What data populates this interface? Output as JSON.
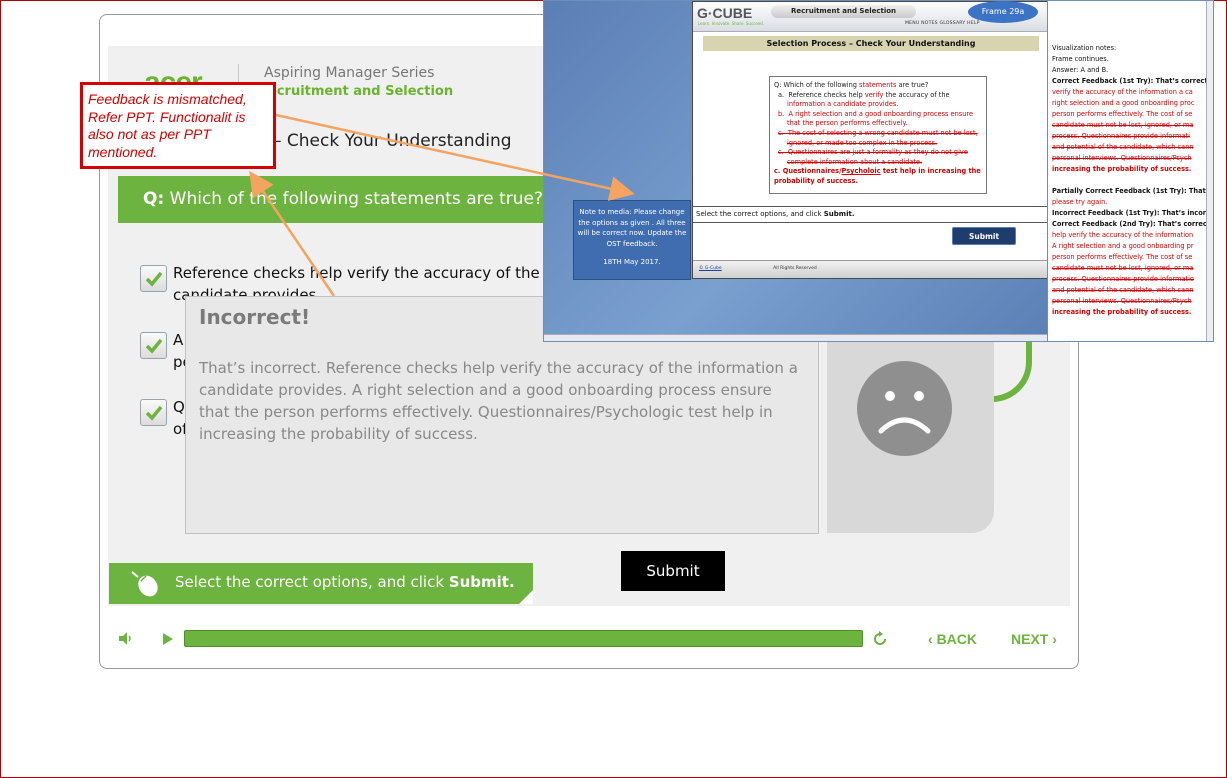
{
  "course": {
    "logo_text": "acer",
    "series": "Aspiring Manager Series",
    "course_title": "Recruitment and Selection",
    "page_title": "– Check Your Understanding"
  },
  "question": {
    "prefix": "Q:",
    "text": "Which of the following statements are true?"
  },
  "options": [
    {
      "line1": "Reference checks help verify the accuracy of the in",
      "line2": "candidate provides.",
      "checked": true
    },
    {
      "line1": "A",
      "line2": "pe",
      "checked": true
    },
    {
      "line1": "Q",
      "line2": "of",
      "checked": true
    }
  ],
  "feedback": {
    "title": "Incorrect!",
    "body": "That’s incorrect. Reference checks help verify the accuracy of the information a candidate provides. A right selection and a good onboarding process ensure that the person performs effectively. Questionnaires/Psychologic test help in increasing the probability of success."
  },
  "submit_label": "Submit",
  "instruction": {
    "text": "Select the correct options, and click ",
    "bold": "Submit."
  },
  "controls": {
    "back_label": "BACK",
    "next_label": "NEXT",
    "progress": 1.0
  },
  "annotation": {
    "text": "Feedback is mismatched, Refer PPT. Functionalit is also not as per PPT mentioned."
  },
  "reference": {
    "logo": "G·CUBE",
    "logo_tagline": "Learn. Innovate. Share. Succeed.",
    "title_pill": "Recruitment and Selection",
    "menu": "MENU    NOTES    GLOSSARY    HELP",
    "frame_badge": "Frame 29a",
    "section": "Selection Process – Check Your Understanding",
    "q_line": "Q: Which of the following statements are true?",
    "q_line_red_word": "statements",
    "opt_a": "a.  Reference checks help verify the accuracy of the information a candidate provides.",
    "opt_b": "b.  A right selection and a good onboarding process ensure that the person performs effectively.",
    "opt_c_strike": "c.  The cost of selecting a wrong candidate must not be lost, ignored, or made too complex in the process.",
    "opt_c2_strike": "c.  Questionnaires are just a formality as they do not give complete information about a candidate.",
    "opt_c3": "c. Questionnaires/Psycholoic test help in increasing the probability of success.",
    "instruction": "Select the correct options, and click ",
    "instruction_bold": "Submit.",
    "submit": "Submit",
    "footer_left": "© G-Cube",
    "footer_mid": "All Rights Reserved",
    "note": "Note to media: Please change the options as given . All three will be correct now.  Update the OST feedback.",
    "note_date": "18TH May 2017.",
    "notes_panel": [
      {
        "t": "Visualization notes:",
        "s": "n"
      },
      {
        "t": "Frame continues.",
        "s": "n"
      },
      {
        "t": "Answer: A and B.",
        "s": "n"
      },
      {
        "t": "Correct Feedback (1st Try): That’s correct!",
        "s": "b"
      },
      {
        "t": "verify the accuracy of the information a ca",
        "s": "r"
      },
      {
        "t": "right selection and a good onboarding proc",
        "s": "r"
      },
      {
        "t": "person performs effectively. The cost of se",
        "s": "r"
      },
      {
        "t": "candidate must not be lost, ignored, or ma",
        "s": "x"
      },
      {
        "t": "process. Questionnaires provide informati",
        "s": "x"
      },
      {
        "t": "and potential of the candidate, which cann",
        "s": "x"
      },
      {
        "t": "personal interviews. Questionnaires/Psych",
        "s": "x"
      },
      {
        "t": "increasing the probability of success.",
        "s": "rb"
      },
      {
        "t": "",
        "s": "n"
      },
      {
        "t": "Partially Correct Feedback (1st Try): That is",
        "s": "b"
      },
      {
        "t": "please try again.",
        "s": "r"
      },
      {
        "t": "Incorrect Feedback (1st Try): That’s incorre",
        "s": "b"
      },
      {
        "t": "Correct Feedback (2nd Try): That’s correct!",
        "s": "b"
      },
      {
        "t": "help verify the accuracy of the information",
        "s": "r"
      },
      {
        "t": "A right selection and a good onboarding pr",
        "s": "r"
      },
      {
        "t": "person performs effectively. The cost of se",
        "s": "r"
      },
      {
        "t": "candidate must not be lost, ignored, or ma",
        "s": "x"
      },
      {
        "t": "process. Questionnaires provide informatio",
        "s": "x"
      },
      {
        "t": "and potential of the candidate, which cann",
        "s": "x"
      },
      {
        "t": "personal interviews. Questionnaires/Psych",
        "s": "x"
      },
      {
        "t": "increasing the probability of success.",
        "s": "rb"
      }
    ]
  }
}
